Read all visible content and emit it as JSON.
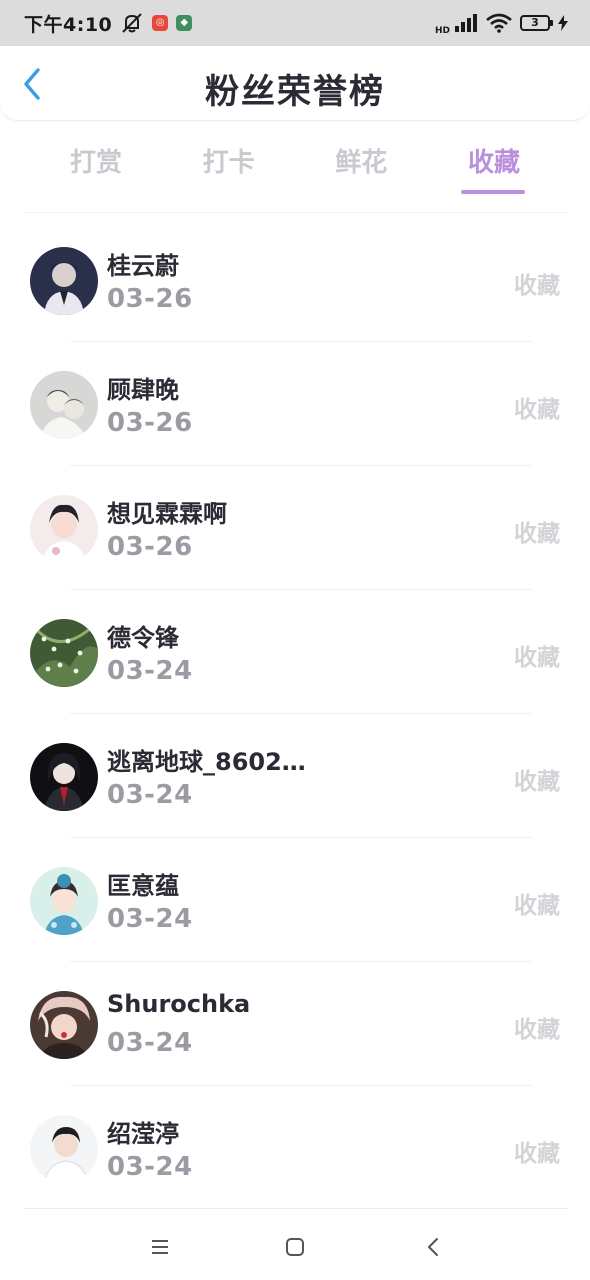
{
  "status_bar": {
    "time": "下午4:10",
    "hd_label": "HD",
    "battery_level": "3"
  },
  "header": {
    "title": "粉丝荣誉榜"
  },
  "tabs": [
    {
      "label": "打赏",
      "active": false
    },
    {
      "label": "打卡",
      "active": false
    },
    {
      "label": "鲜花",
      "active": false
    },
    {
      "label": "收藏",
      "active": true
    }
  ],
  "list": [
    {
      "name": "桂云蔚",
      "date": "03-26",
      "tag": "收藏"
    },
    {
      "name": "顾肆晚",
      "date": "03-26",
      "tag": "收藏"
    },
    {
      "name": "想见霖霖啊",
      "date": "03-26",
      "tag": "收藏"
    },
    {
      "name": "德令锋",
      "date": "03-24",
      "tag": "收藏"
    },
    {
      "name": "逃离地球_8602…",
      "date": "03-24",
      "tag": "收藏"
    },
    {
      "name": "匡意蕴",
      "date": "03-24",
      "tag": "收藏"
    },
    {
      "name": "Shurochka",
      "date": "03-24",
      "tag": "收藏"
    },
    {
      "name": "绍滢渟",
      "date": "03-24",
      "tag": "收藏"
    }
  ],
  "colors": {
    "accent": "#b990dc",
    "back_arrow": "#3a9ee6",
    "title": "#2b2b35",
    "date": "#9b9ba3",
    "tag": "#d4d4d8",
    "inactive_tab": "#c9c9cf"
  },
  "icons": {
    "back": "back-arrow-icon",
    "mute": "mute-icon",
    "signal": "signal-icon",
    "wifi": "wifi-icon",
    "battery": "battery-icon",
    "charging": "charging-bolt-icon",
    "nav_menu": "menu-icon",
    "nav_home": "home-square-icon",
    "nav_back": "back-chevron-icon"
  }
}
